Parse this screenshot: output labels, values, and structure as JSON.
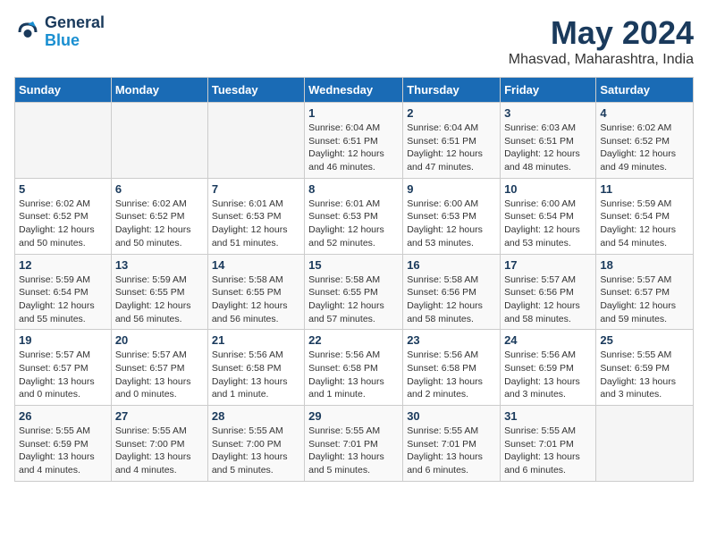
{
  "header": {
    "logo_line1": "General",
    "logo_line2": "Blue",
    "month_title": "May 2024",
    "location": "Mhasvad, Maharashtra, India"
  },
  "weekdays": [
    "Sunday",
    "Monday",
    "Tuesday",
    "Wednesday",
    "Thursday",
    "Friday",
    "Saturday"
  ],
  "weeks": [
    [
      {
        "day": "",
        "info": ""
      },
      {
        "day": "",
        "info": ""
      },
      {
        "day": "",
        "info": ""
      },
      {
        "day": "1",
        "info": "Sunrise: 6:04 AM\nSunset: 6:51 PM\nDaylight: 12 hours and 46 minutes."
      },
      {
        "day": "2",
        "info": "Sunrise: 6:04 AM\nSunset: 6:51 PM\nDaylight: 12 hours and 47 minutes."
      },
      {
        "day": "3",
        "info": "Sunrise: 6:03 AM\nSunset: 6:51 PM\nDaylight: 12 hours and 48 minutes."
      },
      {
        "day": "4",
        "info": "Sunrise: 6:02 AM\nSunset: 6:52 PM\nDaylight: 12 hours and 49 minutes."
      }
    ],
    [
      {
        "day": "5",
        "info": "Sunrise: 6:02 AM\nSunset: 6:52 PM\nDaylight: 12 hours and 50 minutes."
      },
      {
        "day": "6",
        "info": "Sunrise: 6:02 AM\nSunset: 6:52 PM\nDaylight: 12 hours and 50 minutes."
      },
      {
        "day": "7",
        "info": "Sunrise: 6:01 AM\nSunset: 6:53 PM\nDaylight: 12 hours and 51 minutes."
      },
      {
        "day": "8",
        "info": "Sunrise: 6:01 AM\nSunset: 6:53 PM\nDaylight: 12 hours and 52 minutes."
      },
      {
        "day": "9",
        "info": "Sunrise: 6:00 AM\nSunset: 6:53 PM\nDaylight: 12 hours and 53 minutes."
      },
      {
        "day": "10",
        "info": "Sunrise: 6:00 AM\nSunset: 6:54 PM\nDaylight: 12 hours and 53 minutes."
      },
      {
        "day": "11",
        "info": "Sunrise: 5:59 AM\nSunset: 6:54 PM\nDaylight: 12 hours and 54 minutes."
      }
    ],
    [
      {
        "day": "12",
        "info": "Sunrise: 5:59 AM\nSunset: 6:54 PM\nDaylight: 12 hours and 55 minutes."
      },
      {
        "day": "13",
        "info": "Sunrise: 5:59 AM\nSunset: 6:55 PM\nDaylight: 12 hours and 56 minutes."
      },
      {
        "day": "14",
        "info": "Sunrise: 5:58 AM\nSunset: 6:55 PM\nDaylight: 12 hours and 56 minutes."
      },
      {
        "day": "15",
        "info": "Sunrise: 5:58 AM\nSunset: 6:55 PM\nDaylight: 12 hours and 57 minutes."
      },
      {
        "day": "16",
        "info": "Sunrise: 5:58 AM\nSunset: 6:56 PM\nDaylight: 12 hours and 58 minutes."
      },
      {
        "day": "17",
        "info": "Sunrise: 5:57 AM\nSunset: 6:56 PM\nDaylight: 12 hours and 58 minutes."
      },
      {
        "day": "18",
        "info": "Sunrise: 5:57 AM\nSunset: 6:57 PM\nDaylight: 12 hours and 59 minutes."
      }
    ],
    [
      {
        "day": "19",
        "info": "Sunrise: 5:57 AM\nSunset: 6:57 PM\nDaylight: 13 hours and 0 minutes."
      },
      {
        "day": "20",
        "info": "Sunrise: 5:57 AM\nSunset: 6:57 PM\nDaylight: 13 hours and 0 minutes."
      },
      {
        "day": "21",
        "info": "Sunrise: 5:56 AM\nSunset: 6:58 PM\nDaylight: 13 hours and 1 minute."
      },
      {
        "day": "22",
        "info": "Sunrise: 5:56 AM\nSunset: 6:58 PM\nDaylight: 13 hours and 1 minute."
      },
      {
        "day": "23",
        "info": "Sunrise: 5:56 AM\nSunset: 6:58 PM\nDaylight: 13 hours and 2 minutes."
      },
      {
        "day": "24",
        "info": "Sunrise: 5:56 AM\nSunset: 6:59 PM\nDaylight: 13 hours and 3 minutes."
      },
      {
        "day": "25",
        "info": "Sunrise: 5:55 AM\nSunset: 6:59 PM\nDaylight: 13 hours and 3 minutes."
      }
    ],
    [
      {
        "day": "26",
        "info": "Sunrise: 5:55 AM\nSunset: 6:59 PM\nDaylight: 13 hours and 4 minutes."
      },
      {
        "day": "27",
        "info": "Sunrise: 5:55 AM\nSunset: 7:00 PM\nDaylight: 13 hours and 4 minutes."
      },
      {
        "day": "28",
        "info": "Sunrise: 5:55 AM\nSunset: 7:00 PM\nDaylight: 13 hours and 5 minutes."
      },
      {
        "day": "29",
        "info": "Sunrise: 5:55 AM\nSunset: 7:01 PM\nDaylight: 13 hours and 5 minutes."
      },
      {
        "day": "30",
        "info": "Sunrise: 5:55 AM\nSunset: 7:01 PM\nDaylight: 13 hours and 6 minutes."
      },
      {
        "day": "31",
        "info": "Sunrise: 5:55 AM\nSunset: 7:01 PM\nDaylight: 13 hours and 6 minutes."
      },
      {
        "day": "",
        "info": ""
      }
    ]
  ]
}
